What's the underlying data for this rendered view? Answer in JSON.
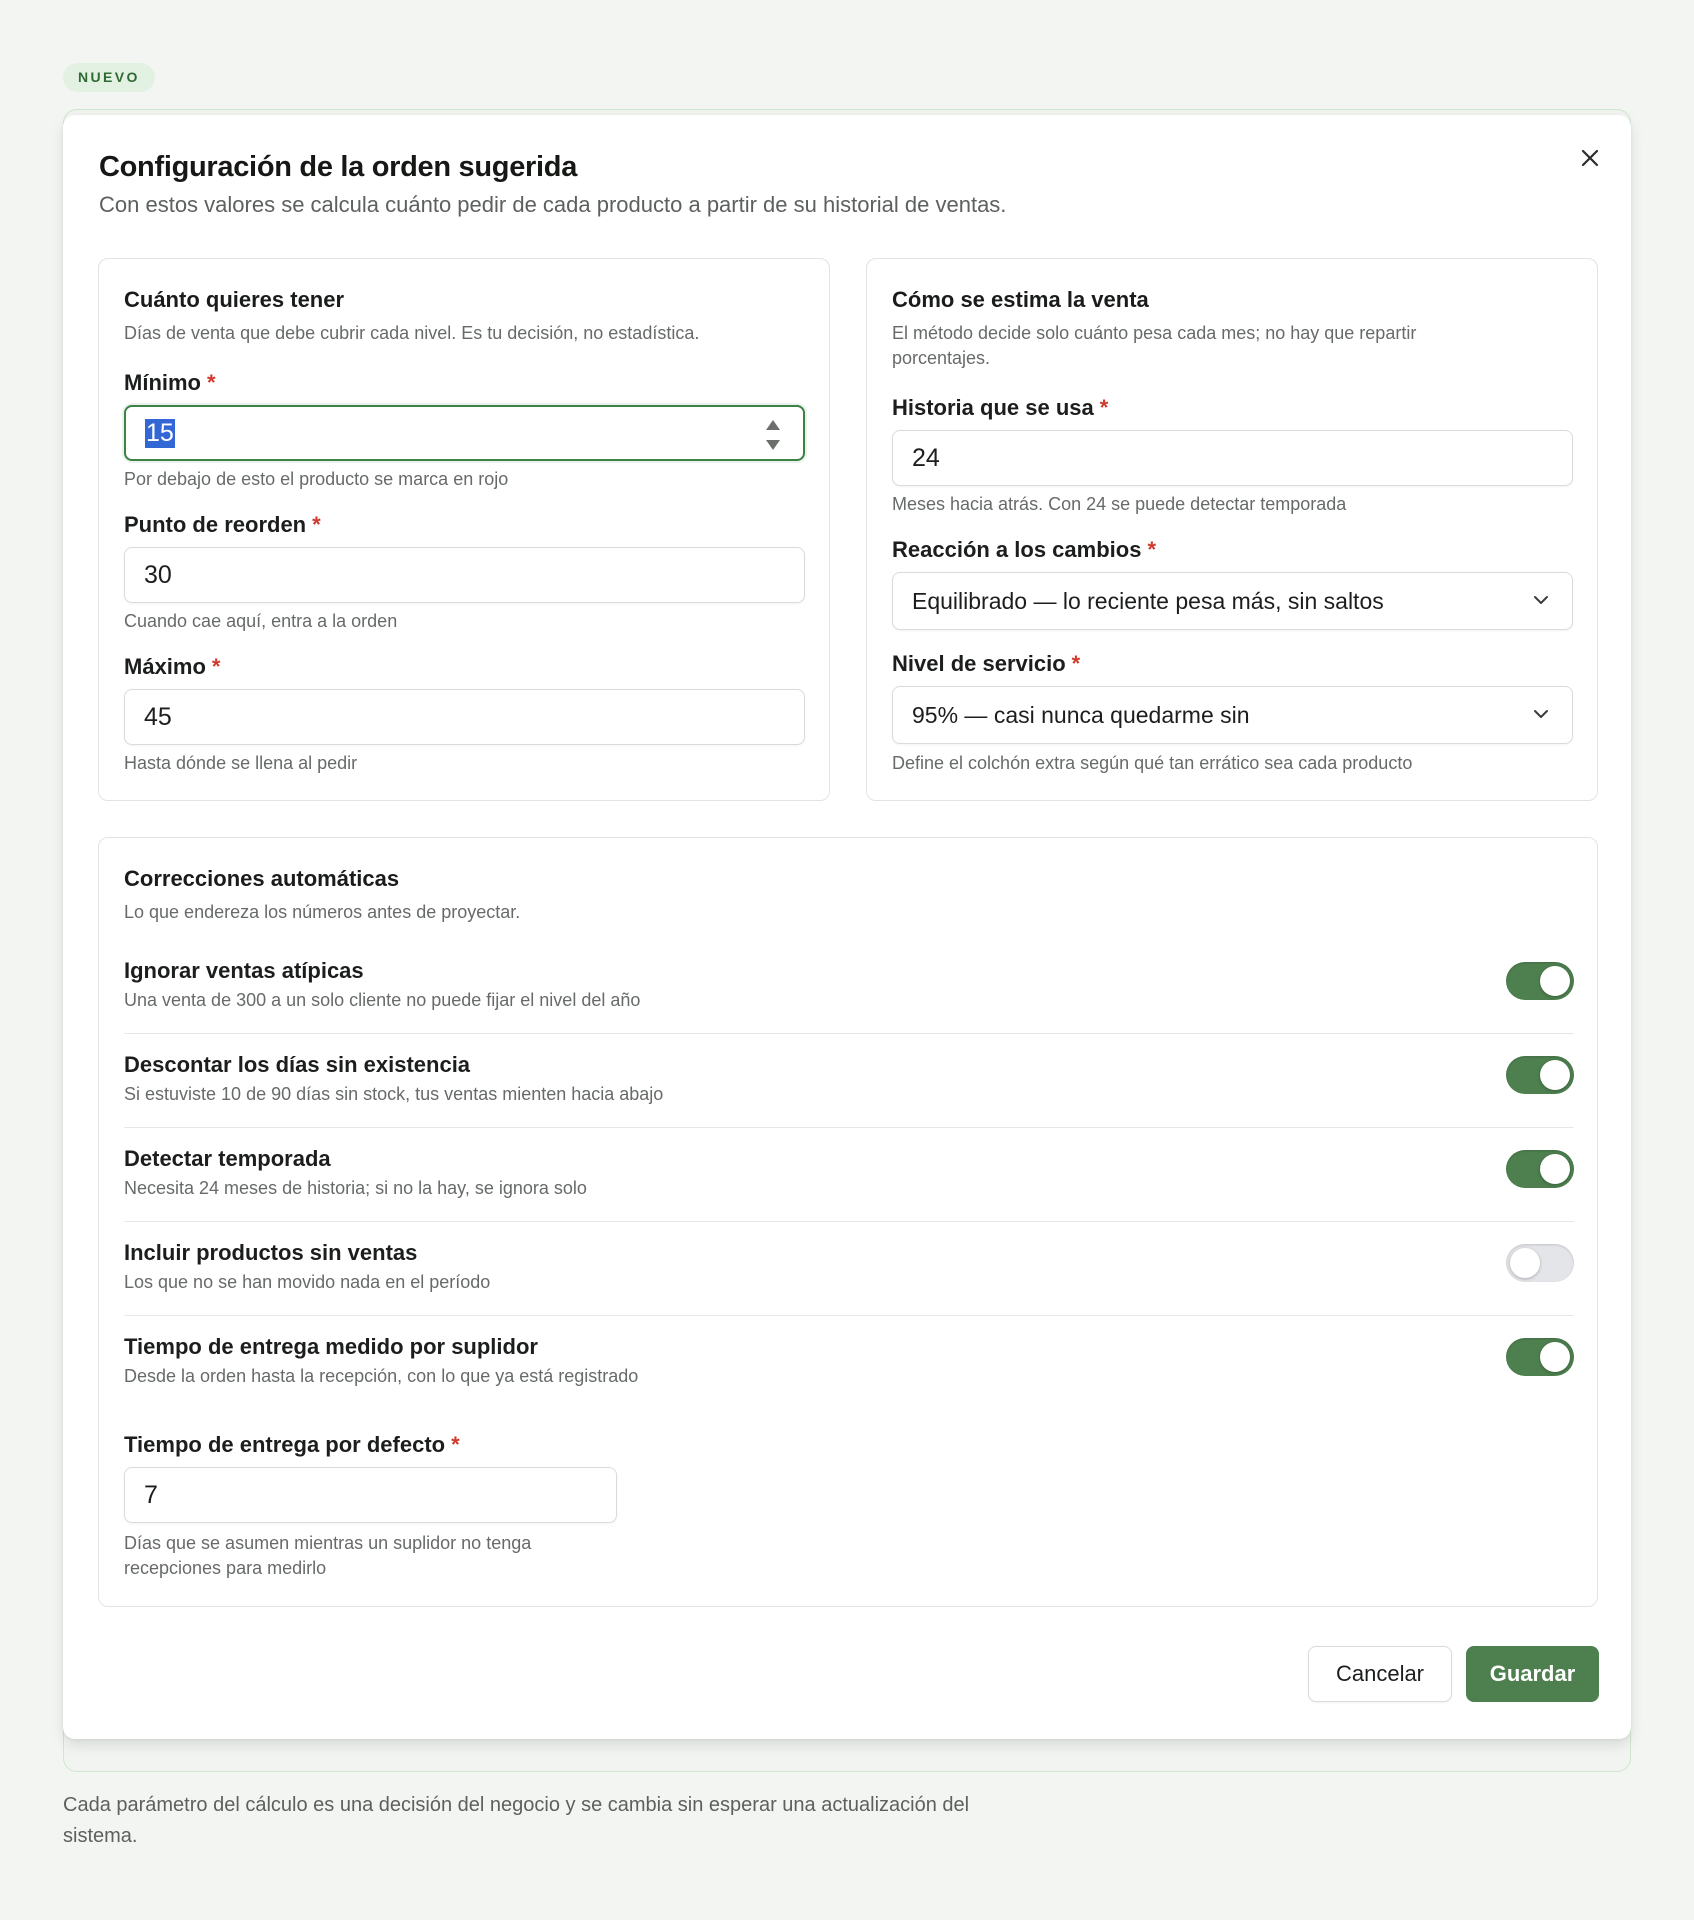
{
  "badge": "NUEVO",
  "modal": {
    "title": "Configuración de la orden sugerida",
    "subtitle": "Con estos valores se calcula cuánto pedir de cada producto a partir de su historial de ventas.",
    "close_icon": "close-icon"
  },
  "stock_card": {
    "title": "Cuánto quieres tener",
    "description": "Días de venta que debe cubrir cada nivel. Es tu decisión, no estadística.",
    "minimum": {
      "label": "Mínimo",
      "value": "15",
      "hint": "Por debajo de esto el producto se marca en rojo"
    },
    "reorder": {
      "label": "Punto de reorden",
      "value": "30",
      "hint": "Cuando cae aquí, entra a la orden"
    },
    "maximum": {
      "label": "Máximo",
      "value": "45",
      "hint": "Hasta dónde se llena al pedir"
    }
  },
  "forecast_card": {
    "title": "Cómo se estima la venta",
    "description_line1": "El método decide solo cuánto pesa cada mes; no hay que repartir",
    "description_line2": "porcentajes.",
    "history": {
      "label": "Historia que se usa",
      "value": "24",
      "hint": "Meses hacia atrás. Con 24 se puede detectar temporada"
    },
    "reaction": {
      "label": "Reacción a los cambios",
      "value": "Equilibrado — lo reciente pesa más, sin saltos"
    },
    "service": {
      "label": "Nivel de servicio",
      "value": "95% — casi nunca quedarme sin",
      "hint": "Define el colchón extra según qué tan errático sea cada producto"
    }
  },
  "corrections_card": {
    "title": "Correcciones automáticas",
    "description": "Lo que endereza los números antes de proyectar.",
    "toggles": [
      {
        "label": "Ignorar ventas atípicas",
        "description": "Una venta de 300 a un solo cliente no puede fijar el nivel del año",
        "on": true
      },
      {
        "label": "Descontar los días sin existencia",
        "description": "Si estuviste 10 de 90 días sin stock, tus ventas mienten hacia abajo",
        "on": true
      },
      {
        "label": "Detectar temporada",
        "description": "Necesita 24 meses de historia; si no la hay, se ignora solo",
        "on": true
      },
      {
        "label": "Incluir productos sin ventas",
        "description": "Los que no se han movido nada en el período",
        "on": false
      },
      {
        "label": "Tiempo de entrega medido por suplidor",
        "description": "Desde la orden hasta la recepción, con lo que ya está registrado",
        "on": true
      }
    ],
    "lead_time": {
      "label": "Tiempo de entrega por defecto",
      "value": "7",
      "hint_line1": "Días que se asumen mientras un suplidor no tenga",
      "hint_line2": "recepciones para medirlo"
    }
  },
  "actions": {
    "cancel": "Cancelar",
    "save": "Guardar"
  },
  "footer": {
    "line1": "Cada parámetro del cálculo es una decisión del negocio y se cambia sin esperar una actualización del",
    "line2": "sistema."
  },
  "colors": {
    "accent": "#4d7f4f",
    "required": "#d0392c",
    "focus": "#3c8145"
  }
}
